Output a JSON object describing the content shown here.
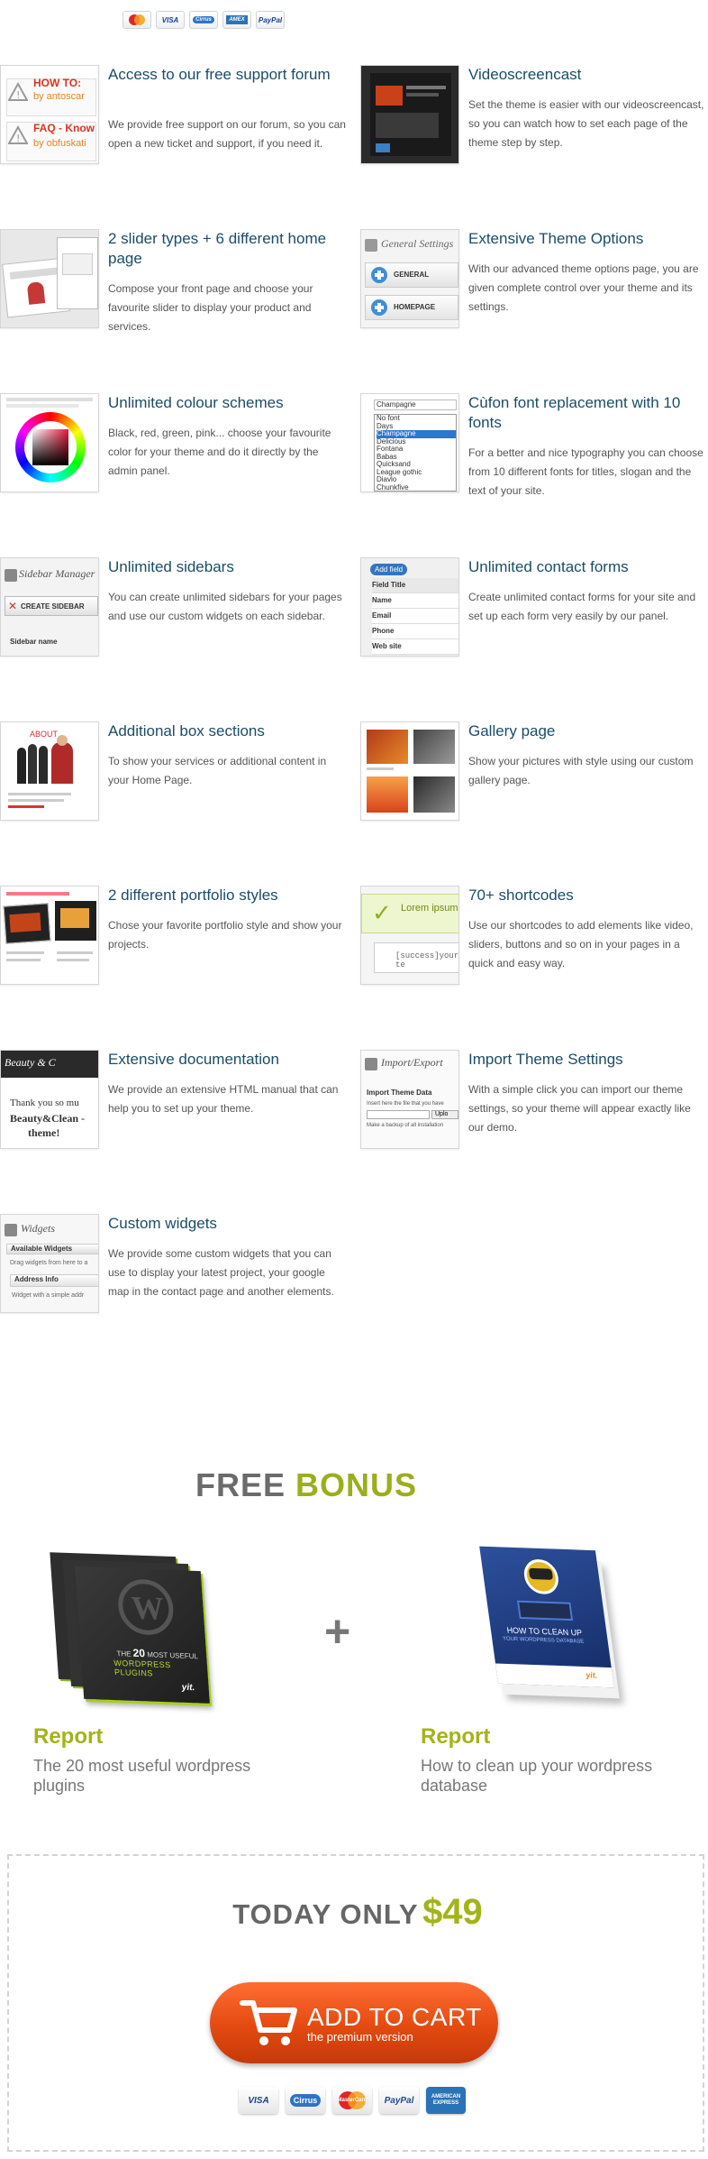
{
  "top_payment_cards": [
    "MasterCard",
    "VISA",
    "Cirrus",
    "AMEX",
    "PayPal"
  ],
  "features": [
    {
      "title": "Access to our free support forum",
      "desc": "We provide free support on our forum, so you can open a new ticket and support, if you need it.",
      "thumb": {
        "line1": "HOW TO:",
        "line2": "by antoscar",
        "line3": "FAQ - Know",
        "line4": "by obfuskati"
      }
    },
    {
      "title": "Videoscreencast",
      "desc": "Set the theme is easier with our videoscreencast, so you can watch how to set each page of the theme step by step."
    },
    {
      "title": "2 slider types + 6 different home page",
      "desc": "Compose your front page and choose your favourite slider to display your product and services."
    },
    {
      "title": "Extensive Theme Options",
      "desc": "With our advanced theme options page, you are given complete control over your theme and its settings.",
      "thumb": {
        "head": "General Settings",
        "b1": "GENERAL",
        "b2": "HOMEPAGE"
      }
    },
    {
      "title": "Unlimited colour schemes",
      "desc": "Black, red, green, pink... choose your favourite color for your theme and do it directly by the admin panel."
    },
    {
      "title": "Cùfon font replacement with 10 fonts",
      "desc": "For a better and nice typography you can choose from 10 different fonts for titles, slogan and the text of your site.",
      "thumb": {
        "fonts": [
          "Champagne",
          "No font",
          "Days",
          "Champagne",
          "Delicious",
          "Fontana",
          "Babas",
          "Quicksand",
          "League gothic",
          "Diavlo",
          "Chunkfive"
        ]
      }
    },
    {
      "title": "Unlimited sidebars",
      "desc": "You can create unlimited sidebars for your pages and use our custom widgets on each sidebar.",
      "thumb": {
        "head": "Sidebar Manager",
        "btn": "CREATE SIDEBAR",
        "lbl": "Sidebar name"
      }
    },
    {
      "title": "Unlimited contact forms",
      "desc": "Create unlimited contact forms for your site and set up each form very easily by our panel.",
      "thumb": {
        "btn": "Add field",
        "rows": [
          "Field Title",
          "Name",
          "Email",
          "Phone",
          "Web site"
        ]
      }
    },
    {
      "title": "Additional box sections",
      "desc": "To show your services or additional content in your Home Page.",
      "thumb": {
        "head": "ABOUT"
      }
    },
    {
      "title": "Gallery page",
      "desc": "Show your pictures with style using our custom gallery page."
    },
    {
      "title": "2 different portfolio styles",
      "desc": "Chose your favorite portfolio style and show your projects."
    },
    {
      "title": "70+ shortcodes",
      "desc": "Use our shortcodes to add elements like video, sliders, buttons and so on in your pages in a quick and easy way.",
      "thumb": {
        "l1": "Lorem ipsum",
        "l2": "[success]your te"
      }
    },
    {
      "title": "Extensive documentation",
      "desc": "We provide an extensive HTML manual that can help you to set up your theme.",
      "thumb": {
        "l1": "Beauty & C",
        "l2": "Thank you so mu",
        "l3": "Beauty&Clean -",
        "l4": "theme!"
      }
    },
    {
      "title": "Import Theme Settings",
      "desc": "With a simple click you can import our theme settings, so your theme will appear exactly like our demo.",
      "thumb": {
        "head": "Import/Export",
        "l1": "Import Theme Data",
        "l2": "Insert here the file that you have",
        "btn": "Uplo",
        "l3": "Make a backup of all installation"
      }
    },
    {
      "title": "Custom widgets",
      "desc": "We provide some custom widgets that you can use to display your latest project, your google map in the contact page and another elements.",
      "thumb": {
        "head": "Widgets",
        "l1": "Available Widgets",
        "l2": "Drag widgets from here to a",
        "l3": "Address Info",
        "l4": "Widget with a simple addr"
      }
    }
  ],
  "bonus": {
    "title_a": "FREE",
    "title_b": "BONUS",
    "plus": "+",
    "book1": {
      "l1": "THE",
      "num": "20",
      "l2": "MOST USEFUL",
      "l3": "WORDPRESS PLUGINS",
      "logo": "yit."
    },
    "book2": {
      "l1": "HOW TO CLEAN UP",
      "l2": "YOUR WORDPRESS DATABASE",
      "logo": "yit."
    },
    "report1": {
      "label": "Report",
      "desc": "The 20 most useful wordpress plugins"
    },
    "report2": {
      "label": "Report",
      "desc": "How to clean up your wordpress database"
    }
  },
  "offer": {
    "today": "TODAY ONLY",
    "price": "$49",
    "cart_label": "ADD TO CART",
    "cart_sub": "the premium version",
    "cards": [
      "VISA",
      "Cirrus",
      "MasterCard",
      "PayPal",
      "AMERICAN EXPRESS"
    ]
  },
  "colors": {
    "title": "#1a4d66",
    "accent": "#9bae1c",
    "cart": "#e34a10"
  }
}
